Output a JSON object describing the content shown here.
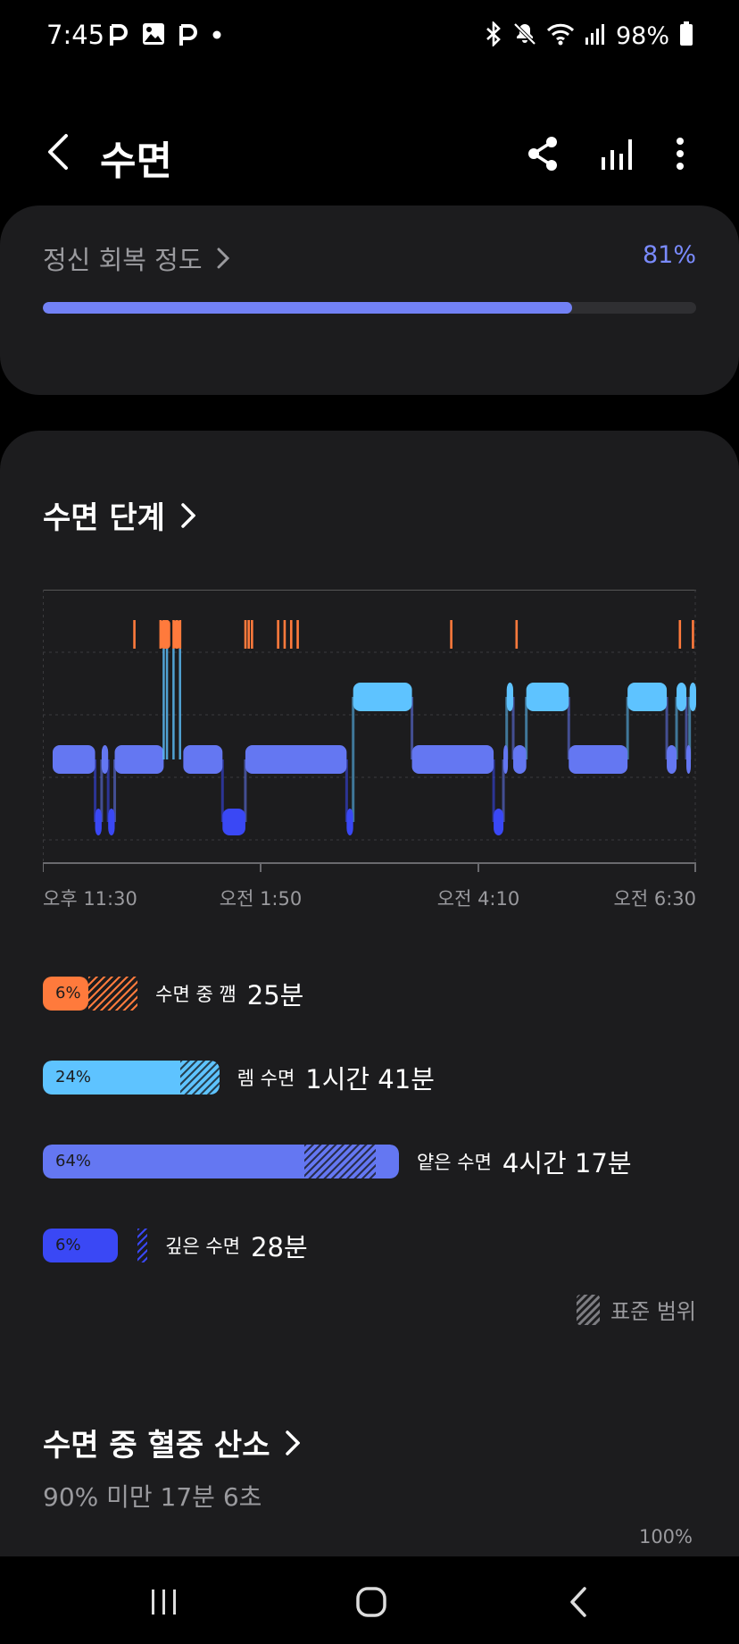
{
  "status_bar": {
    "time": "7:45",
    "battery": "98%",
    "left_icons": [
      "p-notification-icon",
      "image-icon",
      "p-notification-icon",
      "dot-icon"
    ],
    "right_icons": [
      "bluetooth-icon",
      "mute-icon",
      "wifi-icon",
      "signal-icon",
      "battery-icon"
    ]
  },
  "header": {
    "title": "수면",
    "actions": [
      "share-icon",
      "stats-icon",
      "more-icon"
    ]
  },
  "recovery": {
    "label": "정신 회복 정도",
    "value": "81%",
    "progress": 0.81,
    "accent": "#7281f5",
    "value_color": "#7a8bff"
  },
  "stages_section": {
    "title": "수면 단계",
    "axis_labels": [
      "오후 11:30",
      "오전 1:50",
      "오전 4:10",
      "오전 6:30"
    ],
    "colors": {
      "awake": "#ff7a3c",
      "rem": "#5ec3ff",
      "light": "#6477f2",
      "deep": "#3a48f5"
    },
    "hypnogram": {
      "time_range": [
        "오후 11:30",
        "오전 6:30"
      ],
      "awake_marks": [
        0.14,
        0.18,
        0.185,
        0.19,
        0.2,
        0.205,
        0.21,
        0.31,
        0.315,
        0.32,
        0.36,
        0.37,
        0.38,
        0.39,
        0.625,
        0.725,
        0.975,
        0.995
      ],
      "segments": [
        {
          "stage": "light",
          "start": 0.015,
          "end": 0.08
        },
        {
          "stage": "deep",
          "start": 0.08,
          "end": 0.09
        },
        {
          "stage": "light",
          "start": 0.09,
          "end": 0.1
        },
        {
          "stage": "deep",
          "start": 0.1,
          "end": 0.11
        },
        {
          "stage": "light",
          "start": 0.11,
          "end": 0.185
        },
        {
          "stage": "light",
          "start": 0.215,
          "end": 0.275
        },
        {
          "stage": "deep",
          "start": 0.275,
          "end": 0.31
        },
        {
          "stage": "light",
          "start": 0.31,
          "end": 0.465
        },
        {
          "stage": "deep",
          "start": 0.465,
          "end": 0.475
        },
        {
          "stage": "rem",
          "start": 0.475,
          "end": 0.565
        },
        {
          "stage": "light",
          "start": 0.565,
          "end": 0.69
        },
        {
          "stage": "deep",
          "start": 0.69,
          "end": 0.705
        },
        {
          "stage": "light",
          "start": 0.705,
          "end": 0.71
        },
        {
          "stage": "rem",
          "start": 0.71,
          "end": 0.72
        },
        {
          "stage": "light",
          "start": 0.72,
          "end": 0.74
        },
        {
          "stage": "rem",
          "start": 0.74,
          "end": 0.805
        },
        {
          "stage": "light",
          "start": 0.805,
          "end": 0.895
        },
        {
          "stage": "rem",
          "start": 0.895,
          "end": 0.955
        },
        {
          "stage": "light",
          "start": 0.955,
          "end": 0.97
        },
        {
          "stage": "rem",
          "start": 0.97,
          "end": 0.985
        },
        {
          "stage": "light",
          "start": 0.985,
          "end": 0.99
        },
        {
          "stage": "rem",
          "start": 0.99,
          "end": 1.0
        }
      ]
    },
    "stages": [
      {
        "key": "awake",
        "pct": "6%",
        "name": "수면 중 깸",
        "duration": "25분",
        "fill": 0.07,
        "hatch_start": 0.07,
        "hatch_end": 0.145
      },
      {
        "key": "rem",
        "pct": "24%",
        "name": "렘 수면",
        "duration": "1시간 41분",
        "fill": 0.27,
        "hatch_start": 0.21,
        "hatch_end": 0.27
      },
      {
        "key": "light",
        "pct": "64%",
        "name": "얕은 수면",
        "duration": "4시간 17분",
        "fill": 0.545,
        "hatch_start": 0.4,
        "hatch_end": 0.51
      },
      {
        "key": "deep",
        "pct": "6%",
        "name": "깊은 수면",
        "duration": "28분",
        "fill": 0.115,
        "hatch_start": 0.145,
        "hatch_end": 0.16
      }
    ],
    "legend_label": "표준 범위"
  },
  "spo2": {
    "title": "수면 중 혈중 산소",
    "subtitle": "90% 미만 17분 6초",
    "max_label": "100%"
  },
  "navbar": [
    "recent-apps-icon",
    "home-icon",
    "back-icon"
  ]
}
